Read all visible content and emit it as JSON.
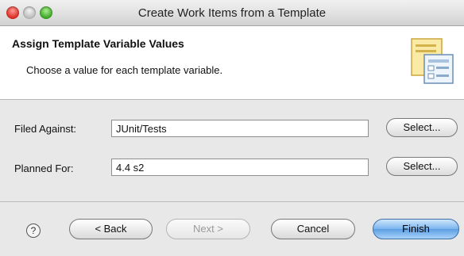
{
  "window": {
    "title": "Create Work Items from a Template"
  },
  "header": {
    "title": "Assign Template Variable Values",
    "description": "Choose a value for each template variable."
  },
  "form": {
    "filed_against": {
      "label": "Filed Against:",
      "value": "JUnit/Tests",
      "button": "Select..."
    },
    "planned_for": {
      "label": "Planned For:",
      "value": "4.4 s2",
      "button": "Select..."
    }
  },
  "footer": {
    "help_glyph": "?",
    "back": "< Back",
    "next": "Next >",
    "cancel": "Cancel",
    "finish": "Finish"
  },
  "colors": {
    "finish_accent": "#6aa8e8",
    "close_light": "#d8291f",
    "max_light": "#3aa124"
  },
  "icons": [
    "wizard-banner-icon",
    "help-icon"
  ]
}
